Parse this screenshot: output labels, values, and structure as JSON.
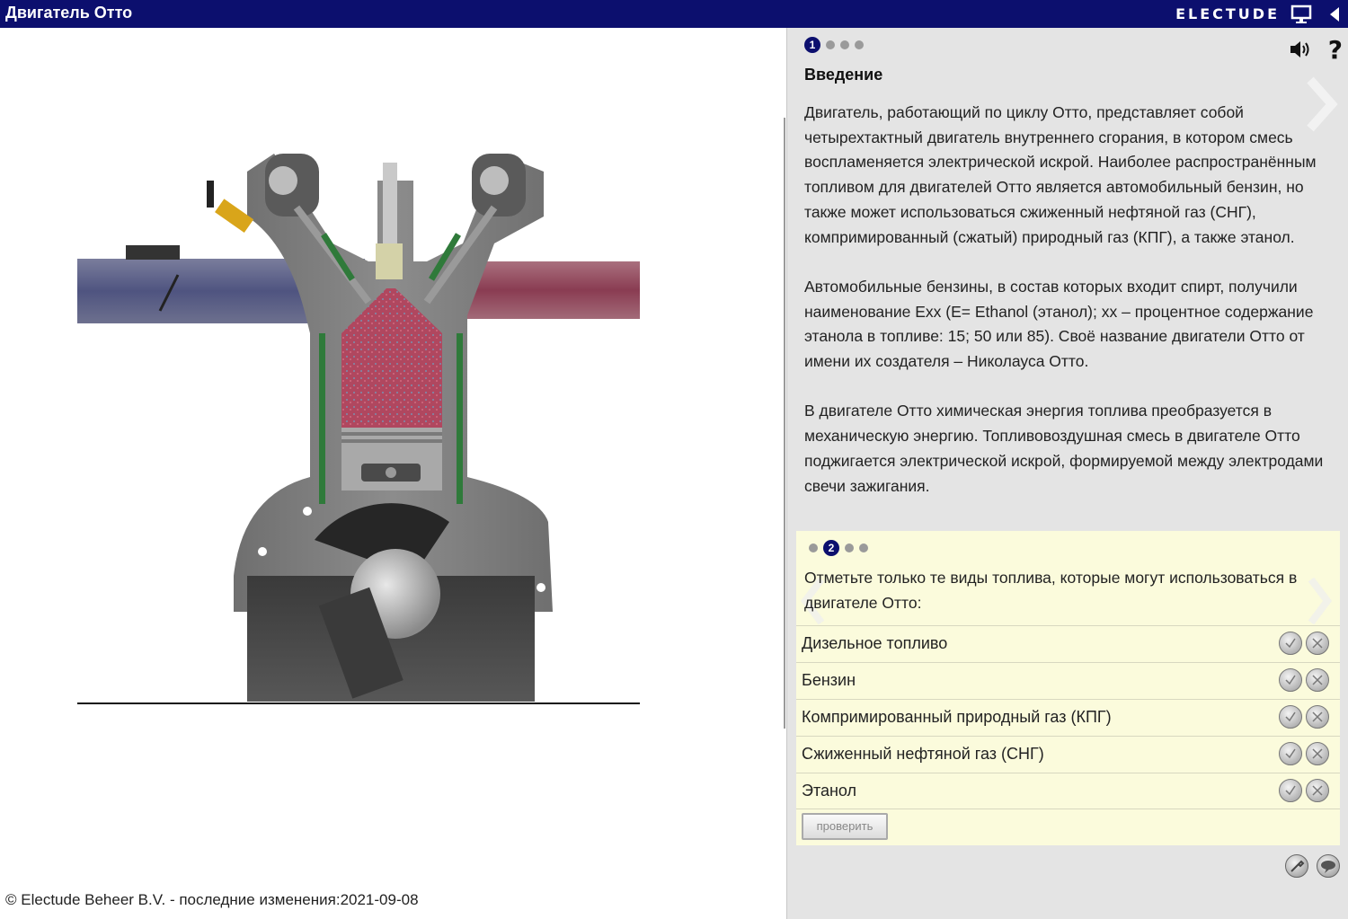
{
  "header": {
    "title": "Двигатель Отто",
    "brand": "ELECTUDE",
    "icons": [
      "presentation-screen-icon",
      "back-arrow-icon"
    ]
  },
  "footer": {
    "text": "© Electude Beheer B.V. - последние изменения:2021-09-08"
  },
  "intro": {
    "step": "1",
    "title": "Введение",
    "paragraphs": [
      "Двигатель, работающий по циклу Отто, представляет собой четырехтактный двигатель внутреннего сгорания, в котором смесь воспламеняется электрической искрой. Наиболее распространённым топливом для двигателей Отто является автомобильный бензин, но также может использоваться сжиженный нефтяной газ (СНГ), компримированный (сжатый) природный газ (КПГ), а также этанол.",
      "Автомобильные бензины, в состав которых входит спирт, получили наименование Exx (E= Ethanol (этанол); xx – процентное содержание этанола в топливе: 15; 50 или 85). Своё название двигатели Отто от имени их создателя – Николауса Отто.",
      "В двигателе Отто химическая энергия топлива преобразуется в механическую энергию. Топливовоздушная смесь в двигателе Отто поджигается электрической искрой, формируемой между электродами свечи зажигания."
    ],
    "help": "?"
  },
  "quiz": {
    "step": "2",
    "question": "Отметьте только те виды топлива, которые могут использоваться в двигателе Отто:",
    "options": [
      "Дизельное топливо",
      "Бензин",
      "Компримированный природный газ (КПГ)",
      "Сжиженный нефтяной газ (СНГ)",
      "Этанол"
    ],
    "check_label": "проверить"
  },
  "colors": {
    "header_bg": "#0c0f6e",
    "panel_bg": "#e4e4e4",
    "quiz_bg": "#fbfbdc"
  }
}
